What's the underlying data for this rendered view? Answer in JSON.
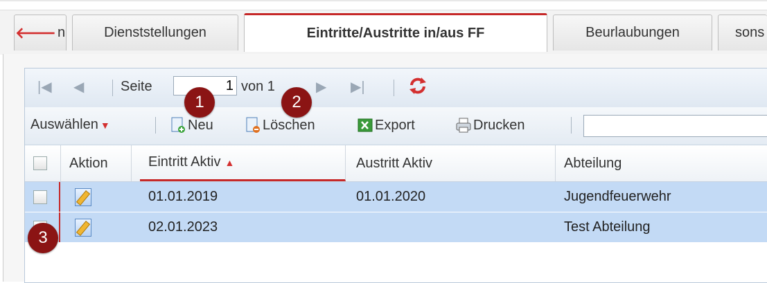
{
  "top_label": "",
  "tabs": [
    {
      "label": "n",
      "active": false
    },
    {
      "label": "Dienststellungen",
      "active": false
    },
    {
      "label": "Eintritte/Austritte in/aus FF",
      "active": true
    },
    {
      "label": "Beurlaubungen",
      "active": false
    },
    {
      "label": "sons",
      "active": false
    }
  ],
  "pager": {
    "page_label": "Seite",
    "page_value": "1",
    "of_label": "von 1"
  },
  "toolbar": {
    "select_label": "Auswählen",
    "new_label": "Neu",
    "delete_label": "Löschen",
    "export_label": "Export",
    "print_label": "Drucken",
    "search_value": ""
  },
  "grid": {
    "columns": [
      "Aktion",
      "Eintritt Aktiv",
      "Austritt Aktiv",
      "Abteilung"
    ],
    "rows": [
      {
        "eintritt": "01.01.2019",
        "austritt": "01.01.2020",
        "abteilung": "Jugendfeuerwehr"
      },
      {
        "eintritt": "02.01.2023",
        "austritt": "",
        "abteilung": "Test Abteilung"
      }
    ]
  },
  "badges": [
    "1",
    "2",
    "3"
  ],
  "colors": {
    "accent": "#c62828",
    "badge": "#8b1414",
    "row_selected": "#c3daf5"
  }
}
